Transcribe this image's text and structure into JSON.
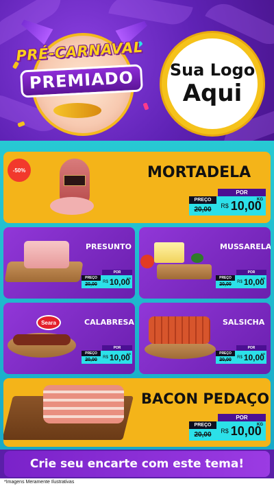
{
  "header": {
    "title_line1": "PRÉ-CARNAVAL",
    "title_line2": "PREMIADO",
    "logo_line1": "Sua Logo",
    "logo_line2": "Aqui"
  },
  "colors": {
    "purple": "#6a1fae",
    "yellow": "#f4b419",
    "cyan": "#2ce0e8",
    "gold": "#f5c21b"
  },
  "products": [
    {
      "name": "MORTADELA",
      "discount": "-50%",
      "por": "POR",
      "preco_label": "PREÇO",
      "old_price": "20,00",
      "currency": "R$",
      "price": "10,00",
      "unit": "KG"
    },
    {
      "name": "PRESUNTO",
      "por": "POR",
      "preco_label": "PREÇO",
      "old_price": "20,00",
      "currency": "R$",
      "price": "10,00",
      "unit": "KG"
    },
    {
      "name": "MUSSARELA",
      "por": "POR",
      "preco_label": "PREÇO",
      "old_price": "20,00",
      "currency": "R$",
      "price": "10,00",
      "unit": "KG"
    },
    {
      "name": "CALABRESA",
      "brand": "Seara",
      "por": "POR",
      "preco_label": "PREÇO",
      "old_price": "20,00",
      "currency": "R$",
      "price": "10,00",
      "unit": "KG"
    },
    {
      "name": "SALSICHA",
      "por": "POR",
      "preco_label": "PREÇO",
      "old_price": "20,00",
      "currency": "R$",
      "price": "10,00",
      "unit": "KG"
    },
    {
      "name": "BACON PEDAÇO",
      "por": "POR",
      "preco_label": "PREÇO",
      "old_price": "20,00",
      "currency": "R$",
      "price": "10,00",
      "unit": "KG"
    }
  ],
  "footer": {
    "cta": "Crie seu encarte com este tema!",
    "disclaimer": "*Imagens Meramente Ilustrativas"
  }
}
